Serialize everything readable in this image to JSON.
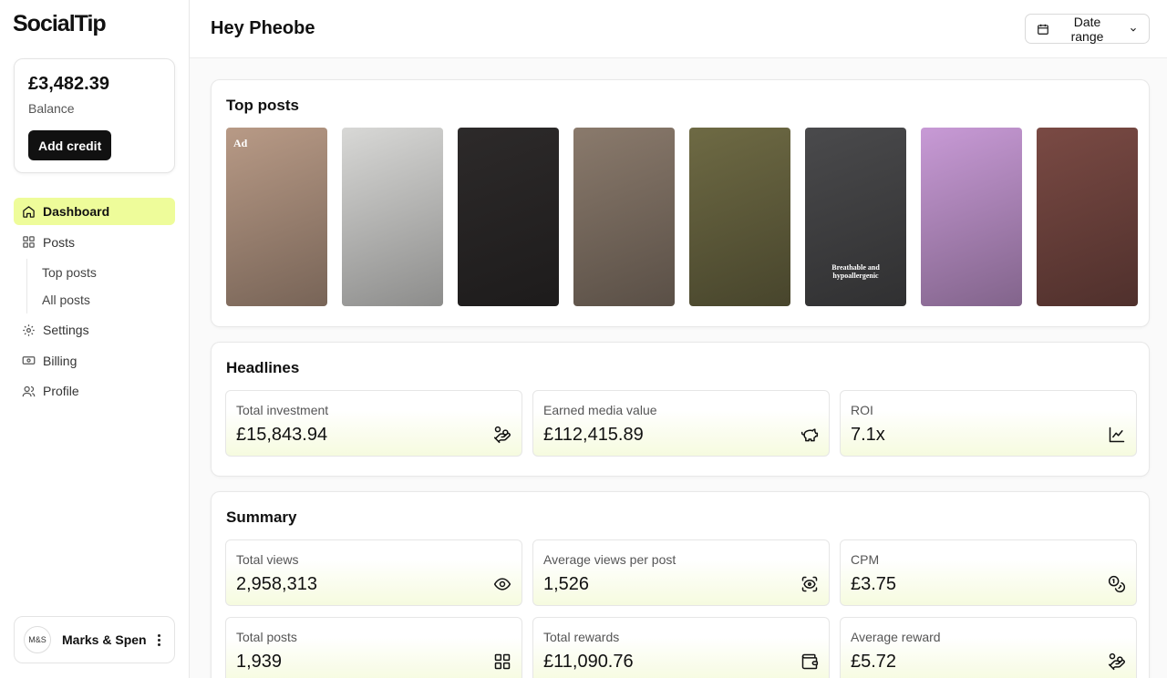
{
  "app": {
    "logo": "SocialTip"
  },
  "balance": {
    "amount": "£3,482.39",
    "label": "Balance",
    "add_credit": "Add credit"
  },
  "nav": {
    "dashboard": "Dashboard",
    "posts": "Posts",
    "top_posts": "Top posts",
    "all_posts": "All posts",
    "settings": "Settings",
    "billing": "Billing",
    "profile": "Profile"
  },
  "account": {
    "avatar": "M&S",
    "name": "Marks & Spencer"
  },
  "header": {
    "greeting": "Hey Pheobe",
    "date_range": "Date range"
  },
  "top_posts": {
    "title": "Top posts",
    "items": [
      {
        "tag": "Ad",
        "caption": "",
        "bg": "#b89a86"
      },
      {
        "tag": "",
        "caption": "",
        "bg": "#d8d8d6"
      },
      {
        "tag": "",
        "caption": "",
        "bg": "#2d2a2a"
      },
      {
        "tag": "",
        "caption": "",
        "bg": "#8a7a6c"
      },
      {
        "tag": "",
        "caption": "",
        "bg": "#6e6a44"
      },
      {
        "tag": "",
        "caption": "Breathable and hypoallergenic",
        "bg": "#4a4a4c"
      },
      {
        "tag": "",
        "caption": "",
        "bg": "#c89ad6"
      },
      {
        "tag": "",
        "caption": "",
        "bg": "#7a4a44"
      }
    ]
  },
  "headlines": {
    "title": "Headlines",
    "items": [
      {
        "label": "Total investment",
        "value": "£15,843.94",
        "icon": "hand-coins-icon"
      },
      {
        "label": "Earned media value",
        "value": "£112,415.89",
        "icon": "piggy-bank-icon"
      },
      {
        "label": "ROI",
        "value": "7.1x",
        "icon": "line-chart-icon"
      }
    ]
  },
  "summary": {
    "title": "Summary",
    "items": [
      {
        "label": "Total views",
        "value": "2,958,313",
        "icon": "eye-icon"
      },
      {
        "label": "Average views per post",
        "value": "1,526",
        "icon": "scan-eye-icon"
      },
      {
        "label": "CPM",
        "value": "£3.75",
        "icon": "coins-icon"
      },
      {
        "label": "Total posts",
        "value": "1,939",
        "icon": "grid-icon"
      },
      {
        "label": "Total rewards",
        "value": "£11,090.76",
        "icon": "wallet-icon"
      },
      {
        "label": "Average reward",
        "value": "£5.72",
        "icon": "hand-coins-icon"
      }
    ]
  },
  "colors": {
    "accent": "#eefc9a",
    "dark": "#111111"
  }
}
